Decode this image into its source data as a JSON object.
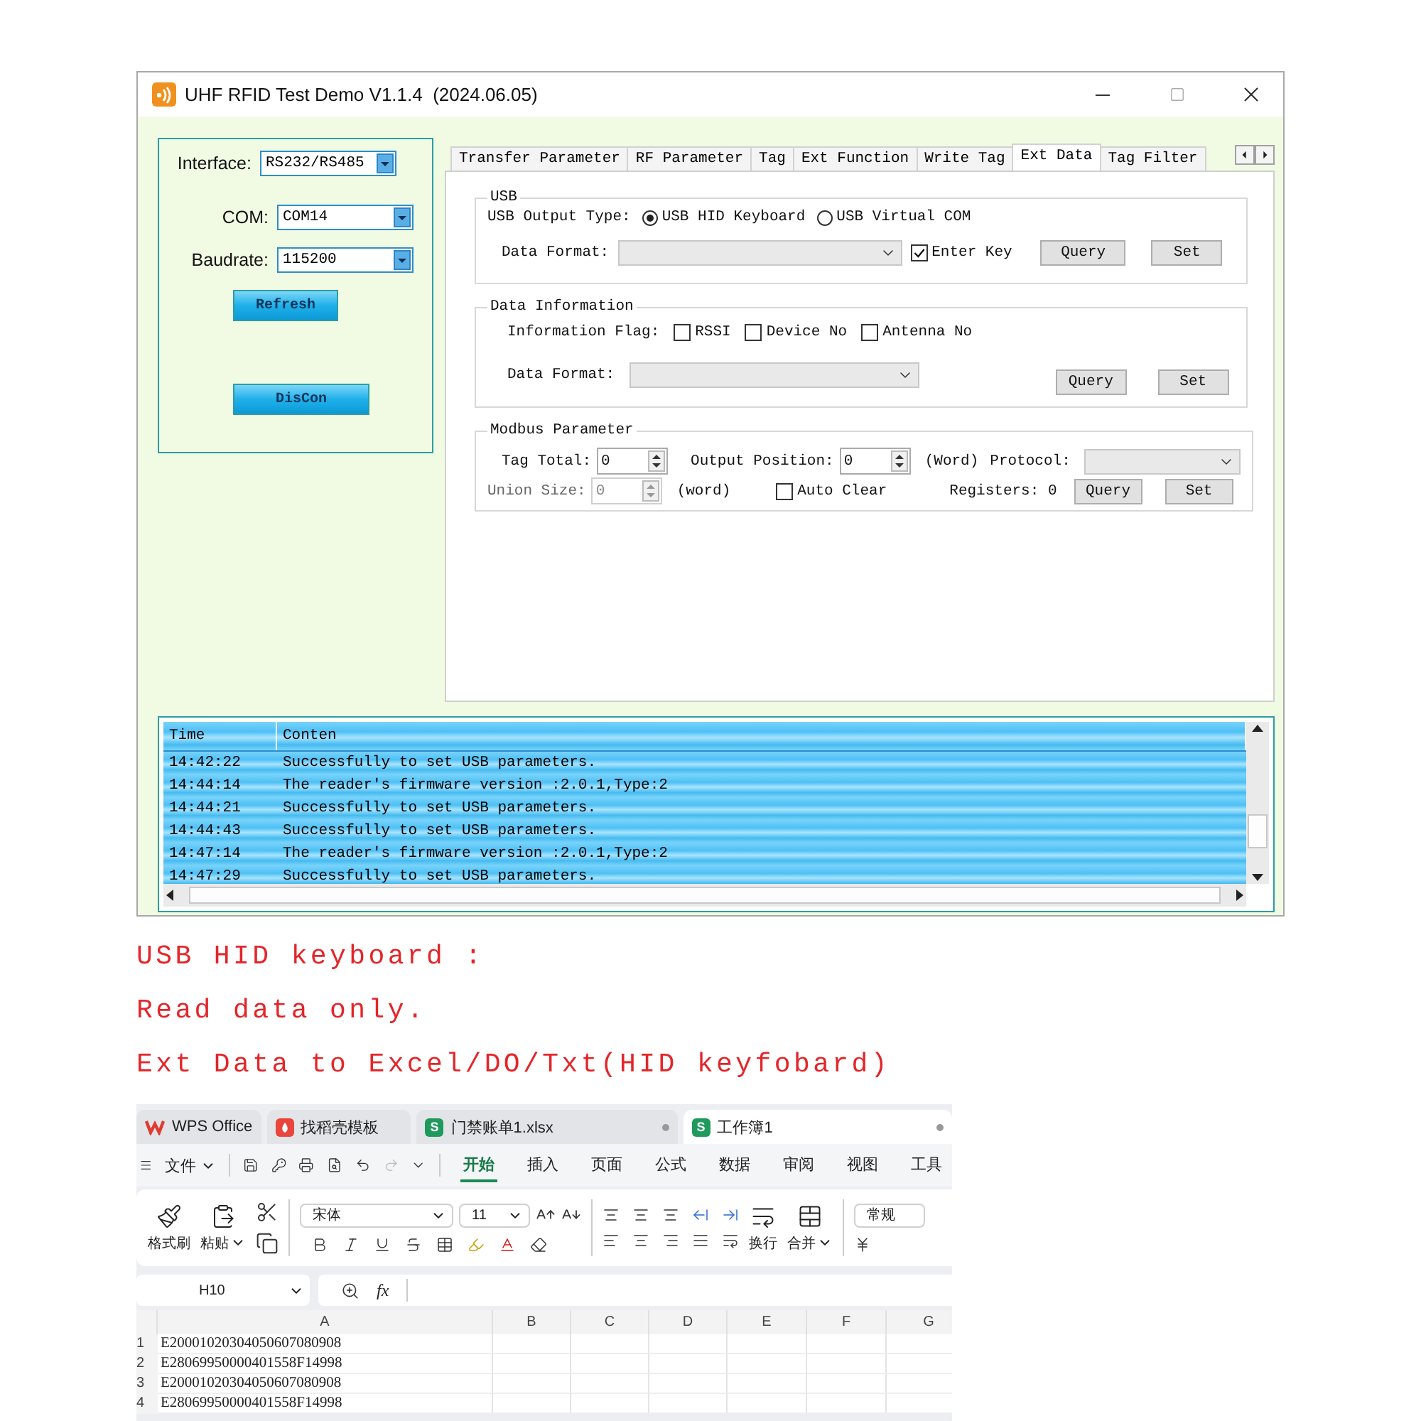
{
  "window": {
    "title": "UHF RFID Test Demo V1.1.4  (2024.06.05)"
  },
  "connection": {
    "fields": [
      {
        "label": "Interface:",
        "value": "RS232/RS485"
      },
      {
        "label": "COM:",
        "value": "COM14"
      },
      {
        "label": "Baudrate:",
        "value": "115200"
      }
    ],
    "buttons": [
      "Refresh",
      "DisCon"
    ]
  },
  "tabs": [
    {
      "label": "Transfer Parameter",
      "selected": false
    },
    {
      "label": "RF Parameter",
      "selected": false
    },
    {
      "label": "Tag",
      "selected": false
    },
    {
      "label": "Ext Function",
      "selected": false
    },
    {
      "label": "Write Tag",
      "selected": false
    },
    {
      "label": "Ext Data",
      "selected": true
    },
    {
      "label": "Tag Filter",
      "selected": false
    }
  ],
  "usb": {
    "title": "USB",
    "output_label": "USB Output Type:",
    "options": [
      {
        "label": "USB HID Keyboard",
        "selected": true
      },
      {
        "label": "USB Virtual COM",
        "selected": false
      }
    ],
    "format_label": "Data Format:",
    "enter_key": {
      "label": "Enter Key",
      "checked": true
    },
    "buttons": [
      "Query",
      "Set"
    ]
  },
  "data_information": {
    "title": "Data Information",
    "flag_label": "Information Flag:",
    "flags": [
      {
        "label": "RSSI",
        "checked": false
      },
      {
        "label": "Device No",
        "checked": false
      },
      {
        "label": "Antenna No",
        "checked": false
      }
    ],
    "format_label": "Data Format:",
    "buttons": [
      "Query",
      "Set"
    ]
  },
  "modbus": {
    "title": "Modbus Parameter",
    "tag_total": {
      "label": "Tag Total:",
      "value": "0",
      "disabled": false
    },
    "output_position": {
      "label": "Output Position:",
      "value": "0",
      "disabled": false
    },
    "output_unit": "(Word)",
    "protocol_label": "Protocol:",
    "union_size": {
      "label": "Union Size:",
      "value": "0",
      "disabled": true
    },
    "union_unit": "(word)",
    "auto_clear": {
      "label": "Auto Clear",
      "checked": false
    },
    "registers": "Registers: 0",
    "buttons": [
      "Query",
      "Set"
    ]
  },
  "log": {
    "columns": [
      "Time",
      "Conten"
    ],
    "rows": [
      {
        "time": "14:42:22",
        "content": "Successfully to set USB parameters."
      },
      {
        "time": "14:44:14",
        "content": "The reader's firmware version :2.0.1,Type:2"
      },
      {
        "time": "14:44:21",
        "content": "Successfully to set USB parameters."
      },
      {
        "time": "14:44:43",
        "content": "Successfully to set USB parameters."
      },
      {
        "time": "14:47:14",
        "content": "The reader's firmware version :2.0.1,Type:2"
      },
      {
        "time": "14:47:29",
        "content": "Successfully to set USB parameters."
      }
    ]
  },
  "notes": [
    "USB HID keyboard :",
    "Read data only.",
    "Ext Data to Excel/DO/Txt(HID keyfobard)"
  ],
  "spreadsheet": {
    "tabs": [
      {
        "kind": "home",
        "label": "WPS Office",
        "selected": false
      },
      {
        "kind": "template",
        "label": "找稻壳模板",
        "selected": false
      },
      {
        "kind": "sheet",
        "badge": "S",
        "label": "门禁账单1.xlsx",
        "selected": false
      },
      {
        "kind": "sheet",
        "badge": "S",
        "label": "工作簿1",
        "selected": true
      }
    ],
    "file_menu": "文件",
    "ribbon_tabs": [
      {
        "label": "开始",
        "selected": true
      },
      {
        "label": "插入",
        "selected": false
      },
      {
        "label": "页面",
        "selected": false
      },
      {
        "label": "公式",
        "selected": false
      },
      {
        "label": "数据",
        "selected": false
      },
      {
        "label": "审阅",
        "selected": false
      },
      {
        "label": "视图",
        "selected": false
      },
      {
        "label": "工具",
        "selected": false
      }
    ],
    "ribbon": {
      "format_painter": "格式刷",
      "paste": "粘贴",
      "font": "宋体",
      "font_size": "11",
      "wrap": "换行",
      "merge": "合并",
      "number_format": "常规"
    },
    "name_box": "H10",
    "fx": "fx",
    "columns": [
      "A",
      "B",
      "C",
      "D",
      "E",
      "F",
      "G"
    ],
    "rows": [
      {
        "number": "1",
        "cells": [
          "E20001020304050607080908"
        ]
      },
      {
        "number": "2",
        "cells": [
          "E28069950000401558F14998"
        ]
      },
      {
        "number": "3",
        "cells": [
          "E20001020304050607080908"
        ]
      },
      {
        "number": "4",
        "cells": [
          "E28069950000401558F14998"
        ]
      }
    ]
  }
}
